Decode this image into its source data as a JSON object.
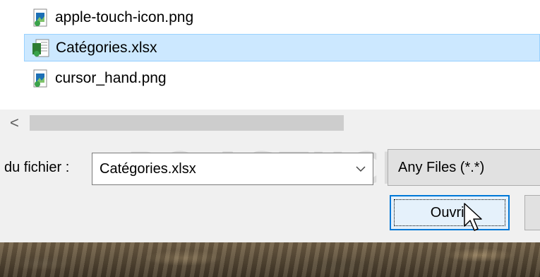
{
  "files": [
    {
      "name": "apple-touch-icon.png",
      "icon": "png-image-icon",
      "selected": false
    },
    {
      "name": "Catégories.xlsx",
      "icon": "excel-file-icon",
      "selected": true
    },
    {
      "name": "cursor_hand.png",
      "icon": "png-image-icon",
      "selected": false
    }
  ],
  "scrollbar": {
    "left_arrow": "<"
  },
  "filename": {
    "label": "du fichier :",
    "value": "Catégories.xlsx"
  },
  "filetype": {
    "value": "Any Files (*.*)"
  },
  "buttons": {
    "open": "Ouvrir"
  },
  "watermark": {
    "text": "PC ASTUCES"
  },
  "colors": {
    "selection": "#cce8ff",
    "accent": "#0078d7"
  }
}
